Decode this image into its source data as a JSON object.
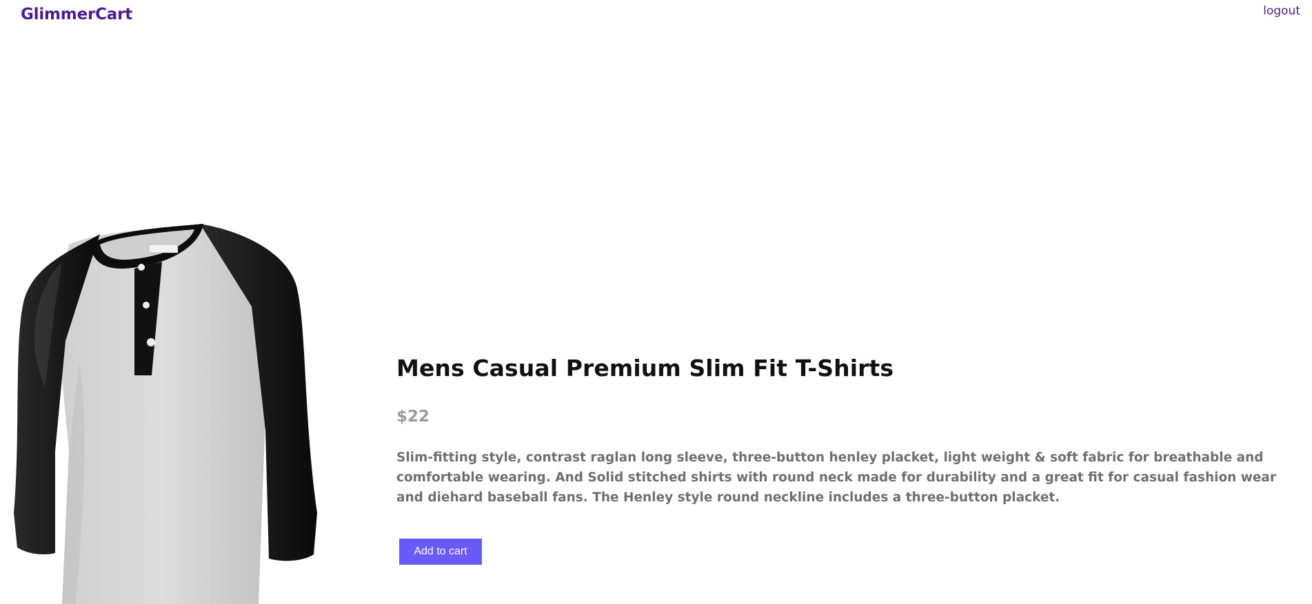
{
  "header": {
    "brand": "GlimmerCart",
    "logout_label": "logout"
  },
  "product": {
    "title": "Mens Casual Premium Slim Fit T-Shirts",
    "price": "$22",
    "description": "Slim-fitting style, contrast raglan long sleeve, three-button henley placket, light weight & soft fabric for breathable and comfortable wearing. And Solid stitched shirts with round neck made for durability and a great fit for casual fashion wear and diehard baseball fans. The Henley style round neckline includes a three-button placket.",
    "image_alt": "Mens Casual Premium Slim Fit T-Shirts",
    "add_to_cart_label": "Add to cart"
  },
  "colors": {
    "brand": "#4b1d8c",
    "button": "#6a5af9",
    "price": "#9b9b9b",
    "description": "#6f6f6f"
  }
}
